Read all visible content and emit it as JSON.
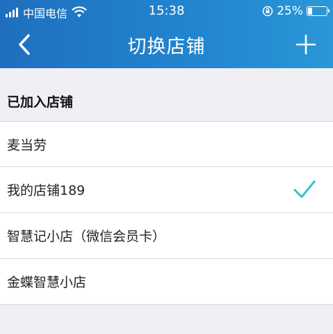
{
  "status_bar": {
    "carrier": "中国电信",
    "time": "15:38",
    "battery": "25%",
    "battery_level": 0.25,
    "icons": [
      "signal-icon",
      "wifi-icon",
      "rotation-lock-icon",
      "battery-icon"
    ]
  },
  "nav": {
    "title": "切换店铺",
    "back_icon": "chevron-left-icon",
    "add_icon": "plus-icon"
  },
  "section": {
    "title": "已加入店铺"
  },
  "stores": [
    {
      "label": "麦当劳",
      "selected": false
    },
    {
      "label": "我的店铺189",
      "selected": true
    },
    {
      "label": "智慧记小店（微信会员卡）",
      "selected": false
    },
    {
      "label": "金蝶智慧小店",
      "selected": false
    }
  ],
  "colors": {
    "header_start": "#1f6fbe",
    "header_end": "#2a97d8",
    "check": "#3bbfcf",
    "background": "#efeff4"
  }
}
